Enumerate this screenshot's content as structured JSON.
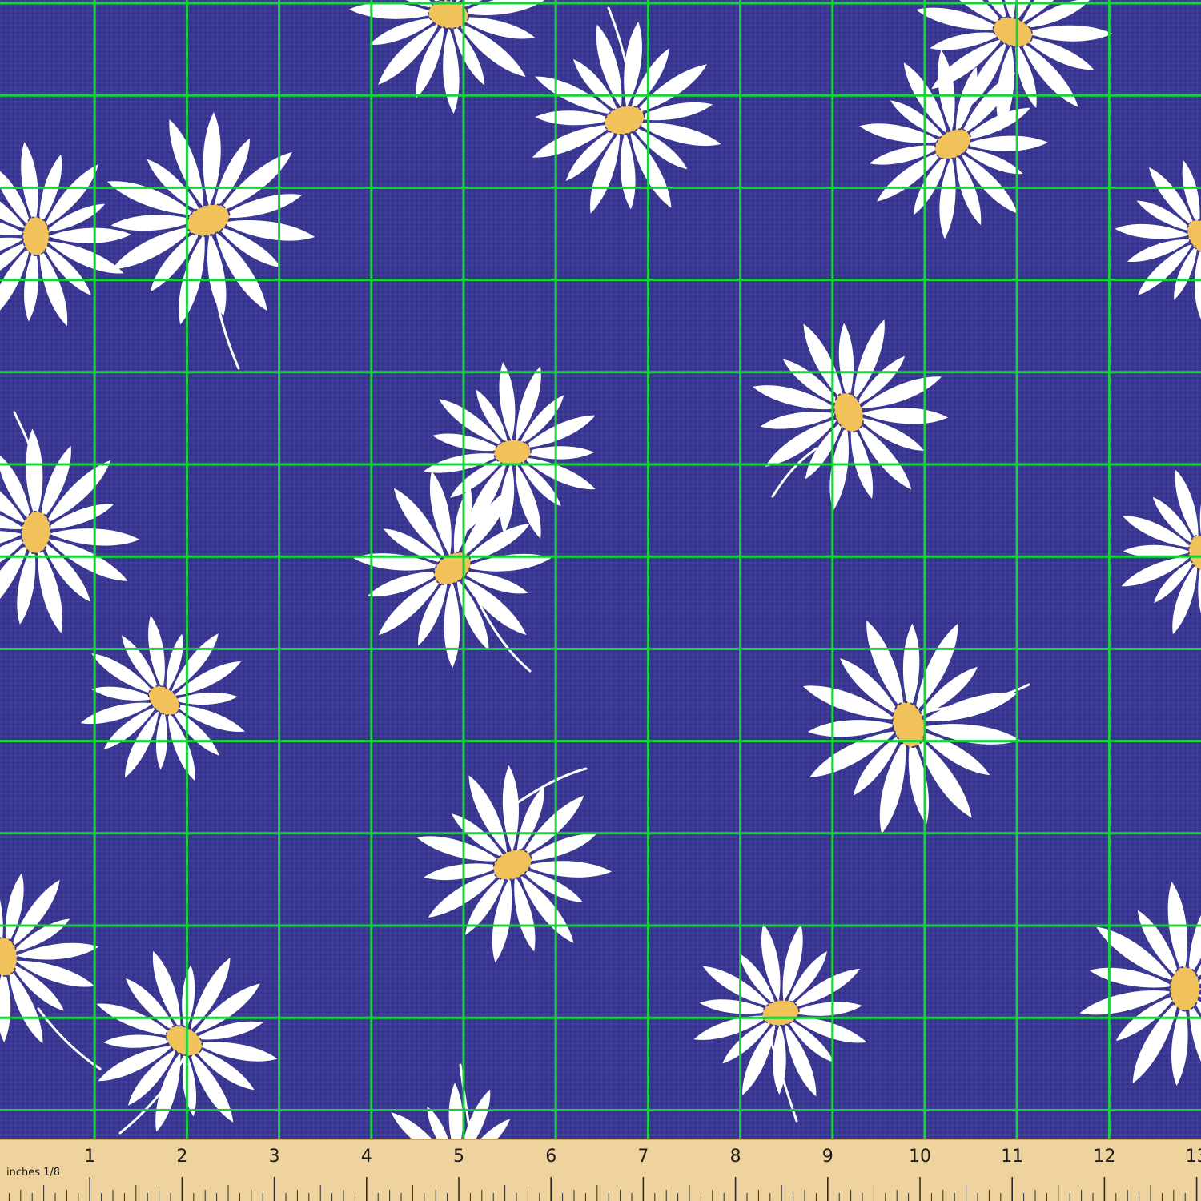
{
  "image": {
    "subject": "fabric-swatch",
    "colors": {
      "background": "#3a3893",
      "petal": "#ffffff",
      "flower_center": "#f2c25a",
      "grid_line": "#17d33a",
      "ruler": "#efd39e"
    },
    "grid": {
      "columns": 13,
      "rows": 13,
      "visible": true
    }
  },
  "ruler": {
    "unit_label": "inches",
    "fraction_label": "1/8",
    "numbers": [
      "1",
      "2",
      "3",
      "4",
      "5",
      "6",
      "7",
      "8",
      "9",
      "10",
      "11",
      "12",
      "13"
    ]
  }
}
